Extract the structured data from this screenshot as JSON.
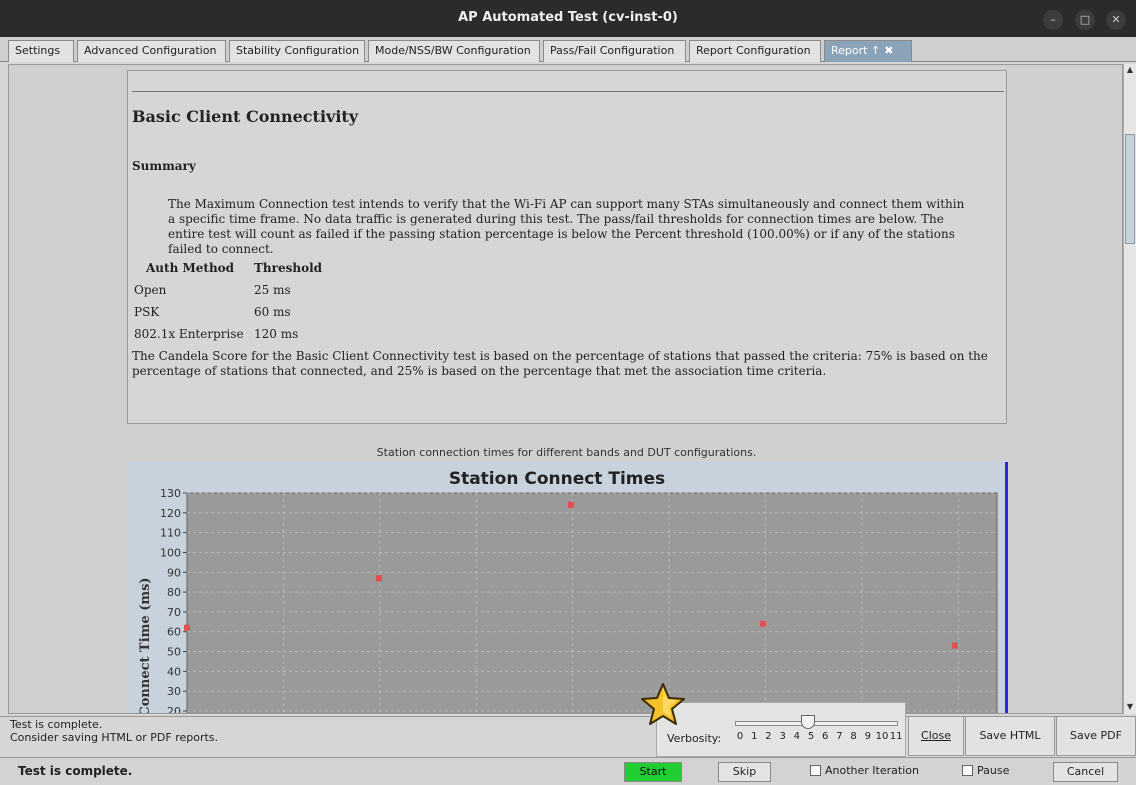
{
  "window": {
    "title": "AP Automated Test  (cv-inst-0)"
  },
  "tabs": [
    {
      "label": "Settings"
    },
    {
      "label": "Advanced Configuration"
    },
    {
      "label": "Stability Configuration"
    },
    {
      "label": "Mode/NSS/BW Configuration"
    },
    {
      "label": "Pass/Fail Configuration"
    },
    {
      "label": "Report Configuration"
    },
    {
      "label": "Report ↑",
      "close": "✖"
    }
  ],
  "report": {
    "heading": "Basic Client Connectivity",
    "subheading": "Summary",
    "summary": "The Maximum Connection test intends to verify that the Wi-Fi AP can support many STAs simultaneously and connect them within a specific time frame. No data traffic is generated during this test. The pass/fail thresholds for connection times are below. The entire test will count as failed if the passing station percentage is below the Percent threshold (100.00%) or if any of the stations failed to connect.",
    "table": {
      "headers": [
        "Auth Method",
        "Threshold"
      ],
      "rows": [
        [
          "Open",
          "25 ms"
        ],
        [
          "PSK",
          "60 ms"
        ],
        [
          "802.1x Enterprise",
          "120 ms"
        ]
      ]
    },
    "score_text": "The Candela Score for the Basic Client Connectivity test is based on the percentage of stations that passed the criteria: 75% is based on the percentage of stations that connected, and 25% is based on the percentage that met the association time criteria.",
    "chart_caption": "Station connection times for different bands and DUT configurations."
  },
  "chart_data": {
    "type": "scatter",
    "title": "Station Connect Times",
    "ylabel": "Connect Time (ms)",
    "xlabel": "",
    "ylim": [
      20,
      130
    ],
    "y_ticks": [
      20,
      30,
      40,
      50,
      60,
      70,
      80,
      90,
      100,
      110,
      120,
      130
    ],
    "grid": true,
    "series": [
      {
        "x": [
          0,
          1,
          2,
          3,
          4
        ],
        "y": [
          62,
          87,
          124,
          64,
          53
        ],
        "color": "#e05050"
      }
    ]
  },
  "status": {
    "line1": "Test is complete.",
    "line2": "Consider saving HTML or PDF reports.",
    "bottom": "Test is complete."
  },
  "verbosity": {
    "label": "Verbosity:",
    "value": 5,
    "ticks": [
      "0",
      "1",
      "2",
      "3",
      "4",
      "5",
      "6",
      "7",
      "8",
      "9",
      "10",
      "11"
    ]
  },
  "buttons": {
    "close": "Close",
    "save_html": "Save HTML",
    "save_pdf": "Save PDF",
    "start": "Start",
    "skip": "Skip",
    "another_iteration": "Another Iteration",
    "pause": "Pause",
    "cancel": "Cancel"
  },
  "colors": {
    "titlebar": "#2b2b2b",
    "active_tab": "#8aa3b8",
    "start_button": "#22cc33",
    "chart_marker": "#e05050"
  }
}
